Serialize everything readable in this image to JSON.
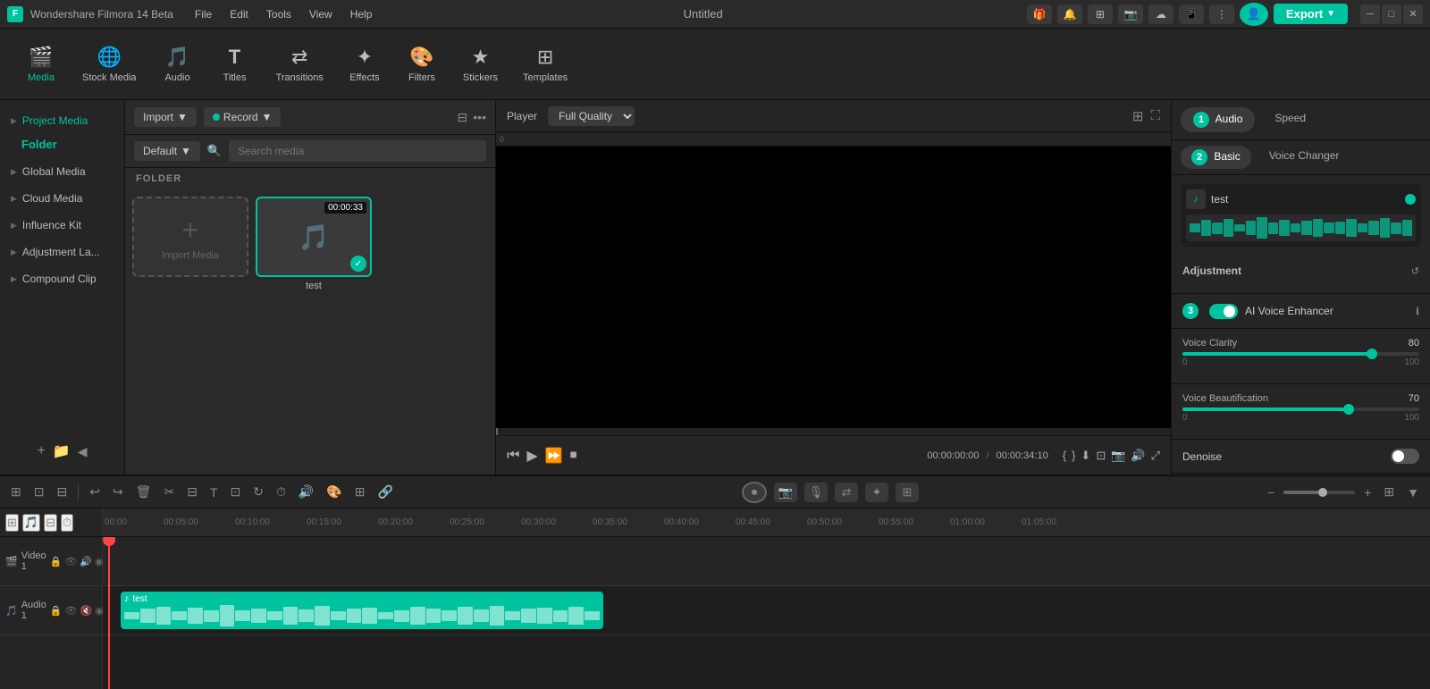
{
  "app": {
    "name": "Wondershare Filmora 14 Beta",
    "title": "Untitled",
    "export_label": "Export"
  },
  "menus": {
    "items": [
      "File",
      "Edit",
      "Tools",
      "View",
      "Help"
    ]
  },
  "toolbar": {
    "items": [
      {
        "id": "media",
        "label": "Media",
        "icon": "🎬",
        "active": true
      },
      {
        "id": "stock_media",
        "label": "Stock Media",
        "icon": "🌐"
      },
      {
        "id": "audio",
        "label": "Audio",
        "icon": "🎵"
      },
      {
        "id": "titles",
        "label": "Titles",
        "icon": "T"
      },
      {
        "id": "transitions",
        "label": "Transitions",
        "icon": "⇄"
      },
      {
        "id": "effects",
        "label": "Effects",
        "icon": "✦"
      },
      {
        "id": "filters",
        "label": "Filters",
        "icon": "🎨"
      },
      {
        "id": "stickers",
        "label": "Stickers",
        "icon": "★"
      },
      {
        "id": "templates",
        "label": "Templates",
        "icon": "⊞"
      }
    ]
  },
  "left_panel": {
    "items": [
      {
        "id": "project_media",
        "label": "Project Media",
        "active": true
      },
      {
        "id": "folder",
        "label": "Folder"
      },
      {
        "id": "global_media",
        "label": "Global Media"
      },
      {
        "id": "cloud_media",
        "label": "Cloud Media"
      },
      {
        "id": "influence_kit",
        "label": "Influence Kit"
      },
      {
        "id": "adjustment_layer",
        "label": "Adjustment La..."
      },
      {
        "id": "compound_clip",
        "label": "Compound Clip"
      }
    ]
  },
  "media_panel": {
    "import_label": "Import",
    "record_label": "Record",
    "default_label": "Default",
    "search_placeholder": "Search media",
    "folder_label": "FOLDER",
    "import_media_label": "Import Media",
    "media_items": [
      {
        "name": "test",
        "duration": "00:00:33",
        "selected": true
      }
    ]
  },
  "preview": {
    "player_label": "Player",
    "quality_label": "Full Quality",
    "current_time": "00:00:00:00",
    "total_time": "00:00:34:10"
  },
  "right_panel": {
    "tab1_label": "Audio",
    "tab2_label": "Speed",
    "sub_tab1_label": "Basic",
    "sub_tab2_label": "Voice Changer",
    "badge_num": "1",
    "badge_num2": "2",
    "badge_num3": "3",
    "audio_track_name": "test",
    "adjustment_label": "Adjustment",
    "ai_voice_label": "AI Voice Enhancer",
    "voice_clarity_label": "Voice Clarity",
    "voice_clarity_value": "80",
    "voice_clarity_pct": 80,
    "voice_beautification_label": "Voice Beautification",
    "voice_beautification_value": "70",
    "voice_beautification_pct": 70,
    "denoise_label": "Denoise",
    "slider_min": "0",
    "slider_max": "100"
  },
  "timeline": {
    "track_names": [
      "Video 1",
      "Audio 1"
    ],
    "ruler_marks": [
      "00:00",
      "00:05:00",
      "00:10:00",
      "00:15:00",
      "00:20:00",
      "00:25:00",
      "00:30:00",
      "00:35:00",
      "00:40:00",
      "00:45:00",
      "00:50:00",
      "00:55:00",
      "01:00:00",
      "01:05:00"
    ],
    "audio_clip_name": "test",
    "zoom_level": "55"
  }
}
